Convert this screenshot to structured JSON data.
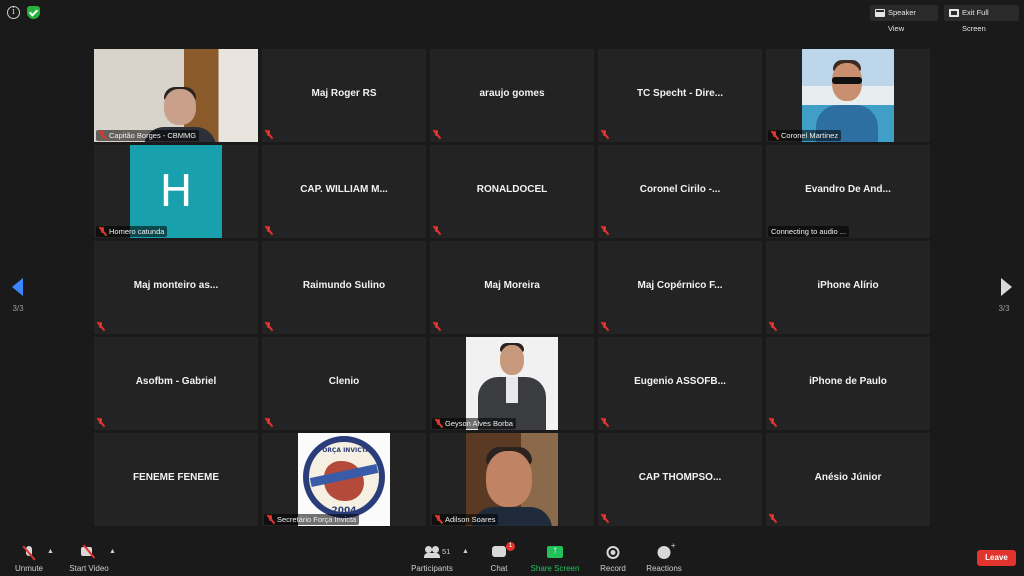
{
  "top_bar": {
    "speaker_view_label": "Speaker View",
    "exit_full_screen_label": "Exit Full Screen",
    "icons": [
      "info-icon",
      "encryption-shield-icon",
      "speaker-view-icon",
      "exit-full-screen-icon"
    ]
  },
  "navigation": {
    "page_indicator_left": "3/3",
    "page_indicator_right": "3/3",
    "accent_color": "#3b87ff"
  },
  "participants": [
    {
      "display": "video",
      "footer": "Capitão Borges - CBMMG",
      "muted": true
    },
    {
      "display": "name",
      "name": "Maj Roger RS",
      "muted": true
    },
    {
      "display": "name",
      "name": "araujo gomes",
      "muted": true
    },
    {
      "display": "name",
      "name": "TC Specht - Dire...",
      "muted": true
    },
    {
      "display": "photo",
      "footer": "Coronel Martinez",
      "muted": true
    },
    {
      "display": "avatar",
      "avatar_letter": "H",
      "avatar_color": "#18a1ac",
      "footer": "Homero catunda",
      "muted": true
    },
    {
      "display": "name",
      "name": "CAP. WILLIAM M...",
      "muted": true
    },
    {
      "display": "name",
      "name": "RONALDOCEL",
      "muted": true
    },
    {
      "display": "name",
      "name": "Coronel Cirilo -...",
      "muted": true
    },
    {
      "display": "name",
      "name": "Evandro De And...",
      "status": "Connecting to audio ..."
    },
    {
      "display": "name",
      "name": "Maj monteiro as...",
      "muted": true
    },
    {
      "display": "name",
      "name": "Raimundo Sulino",
      "muted": true
    },
    {
      "display": "name",
      "name": "Maj Moreira",
      "muted": true
    },
    {
      "display": "name",
      "name": "Maj Copérnico F...",
      "muted": true
    },
    {
      "display": "name",
      "name": "iPhone Alírio",
      "muted": true
    },
    {
      "display": "name",
      "name": "Asofbm - Gabriel",
      "muted": true
    },
    {
      "display": "name",
      "name": "Clenio",
      "muted": true
    },
    {
      "display": "photo",
      "footer": "Geyson Alves Borba",
      "muted": true
    },
    {
      "display": "name",
      "name": "Eugenio  ASSOFB...",
      "muted": true
    },
    {
      "display": "name",
      "name": "iPhone de Paulo",
      "muted": true
    },
    {
      "display": "name",
      "name": "FENEME FENEME",
      "muted": false
    },
    {
      "display": "logo",
      "footer": "Secretário Força  Invicta",
      "logo_top_text": "FORÇA INVICTA",
      "logo_year": "2004",
      "muted": true
    },
    {
      "display": "photo",
      "footer": "Adilson Soares",
      "muted": true
    },
    {
      "display": "name",
      "name": "CAP  THOMPSO...",
      "muted": true
    },
    {
      "display": "name",
      "name": "Anésio Júnior",
      "muted": true
    }
  ],
  "toolbar": {
    "unmute_label": "Unmute",
    "start_video_label": "Start Video",
    "participants_label": "Participants",
    "participants_count": "51",
    "chat_label": "Chat",
    "chat_badge": "1",
    "share_screen_label": "Share Screen",
    "record_label": "Record",
    "reactions_label": "Reactions",
    "leave_label": "Leave",
    "share_color": "#23c15a",
    "leave_color": "#e0342c"
  }
}
